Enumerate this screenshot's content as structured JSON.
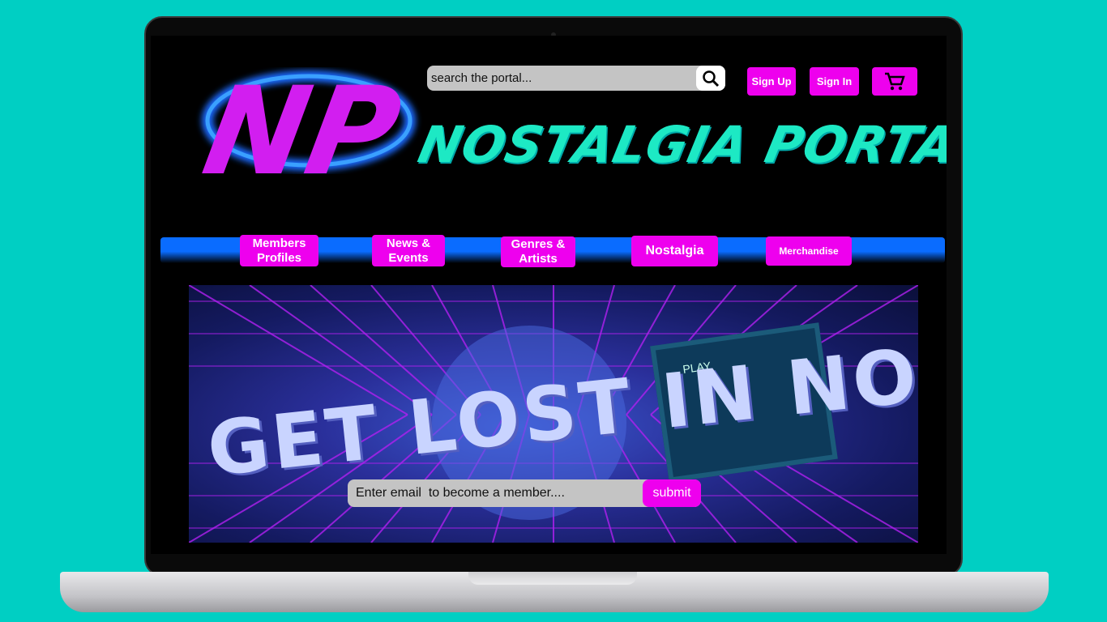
{
  "site": {
    "title": "NOSTALGIA PORTAL",
    "logo_text": "NP"
  },
  "search": {
    "placeholder": "search the portal...",
    "icon": "magnifier"
  },
  "header_buttons": {
    "sign_up": "Sign Up",
    "sign_in": "Sign In",
    "cart_icon": "shopping-cart"
  },
  "nav": {
    "items": [
      {
        "label": "Members Profiles"
      },
      {
        "label": "News & Events"
      },
      {
        "label": "Genres & Artists"
      },
      {
        "label": "Nostalgia"
      },
      {
        "label": "Merchandise"
      }
    ]
  },
  "hero": {
    "headline": "GET LOST IN NOSTALGIA",
    "screen_text": "PLAY"
  },
  "signup_form": {
    "placeholder": "Enter email  to become a member....",
    "submit_label": "submit"
  },
  "colors": {
    "background": "#00cfc3",
    "accent_magenta": "#ee00ee",
    "title_teal": "#1de9c4",
    "nav_blue": "#0a6cff"
  }
}
